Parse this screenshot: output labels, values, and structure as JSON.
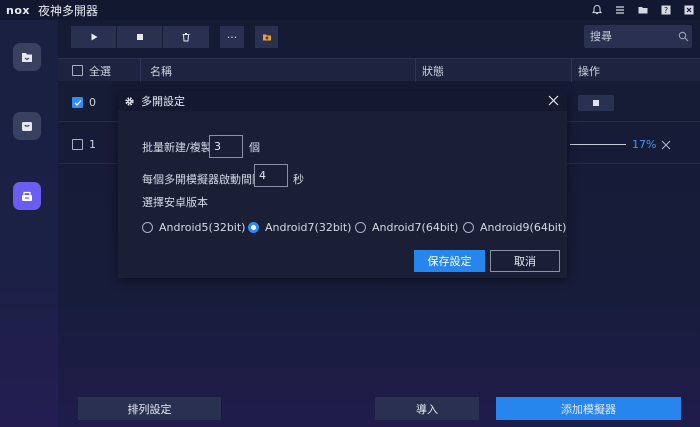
{
  "app": {
    "logo": "nox",
    "title": "夜神多開器"
  },
  "titlebar_icons": [
    "bell-icon",
    "menu-icon",
    "folder-icon",
    "help-icon",
    "close-icon"
  ],
  "sidebar": {
    "items": [
      "emulator-icon",
      "store-icon",
      "multi-instance-icon"
    ],
    "active_index": 2
  },
  "toolbar": {
    "buttons": [
      "play-icon",
      "stop-icon",
      "trash-icon",
      "more-icon",
      "folder-import-icon"
    ],
    "more_label": "···",
    "search_placeholder": "搜尋"
  },
  "table": {
    "headers": {
      "select_all": "全選",
      "name": "名稱",
      "status": "狀態",
      "action": "操作"
    },
    "rows": [
      {
        "index": "0",
        "checked": true
      },
      {
        "index": "1",
        "checked": false,
        "progress_text": "17%",
        "progress": 0.17
      }
    ]
  },
  "dialog": {
    "title": "多開設定",
    "batch_label": "批量新建/複製",
    "batch_value": "3",
    "batch_unit": "個",
    "interval_label": "每個多開模擬器啟動間隔",
    "interval_value": "4",
    "interval_unit": "秒",
    "android_label": "選擇安卓版本",
    "options": [
      "Android5(32bit)",
      "Android7(32bit)",
      "Android7(64bit)",
      "Android9(64bit)"
    ],
    "selected_option": 1,
    "save": "保存設定",
    "cancel": "取消"
  },
  "footer": {
    "arrange": "排列設定",
    "import": "導入",
    "add": "添加模擬器"
  },
  "colors": {
    "accent": "#2686ee",
    "progress": "#3b97ff",
    "sidebar_active": "#6a5df0"
  }
}
